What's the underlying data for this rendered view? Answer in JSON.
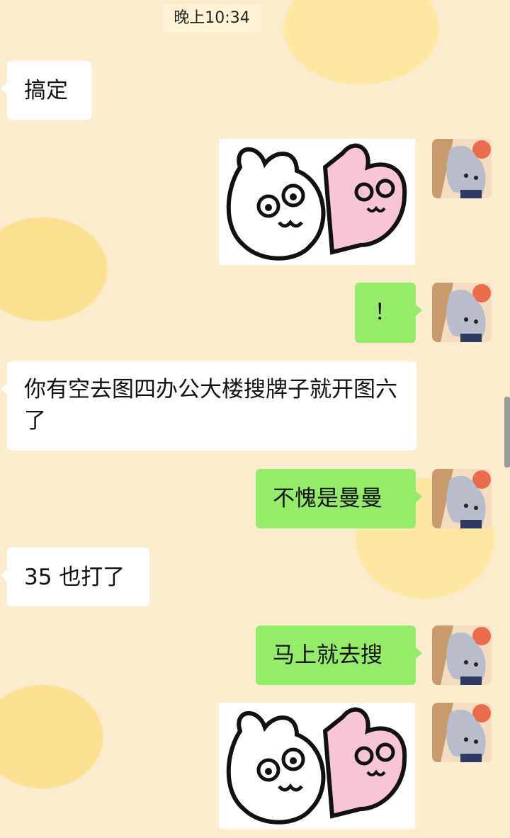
{
  "status": {
    "time": "晚上10:34"
  },
  "messages": [
    {
      "side": "in",
      "type": "text",
      "text": "搞定"
    },
    {
      "side": "out",
      "type": "sticker",
      "sticker_name": "bunny-hug-sticker"
    },
    {
      "side": "out",
      "type": "text",
      "text": "！"
    },
    {
      "side": "in",
      "type": "text",
      "text": "你有空去图四办公大楼搜牌子就开图六了"
    },
    {
      "side": "out",
      "type": "text",
      "text": "不愧是曼曼"
    },
    {
      "side": "in",
      "type": "text",
      "text": "35 也打了"
    },
    {
      "side": "out",
      "type": "text",
      "text": "马上就去搜"
    },
    {
      "side": "out",
      "type": "sticker",
      "sticker_name": "bunny-hug-sticker"
    }
  ],
  "colors": {
    "incoming_bubble": "#ffffff",
    "outgoing_bubble": "#95ec69",
    "wallpaper": "#fbeccd"
  }
}
